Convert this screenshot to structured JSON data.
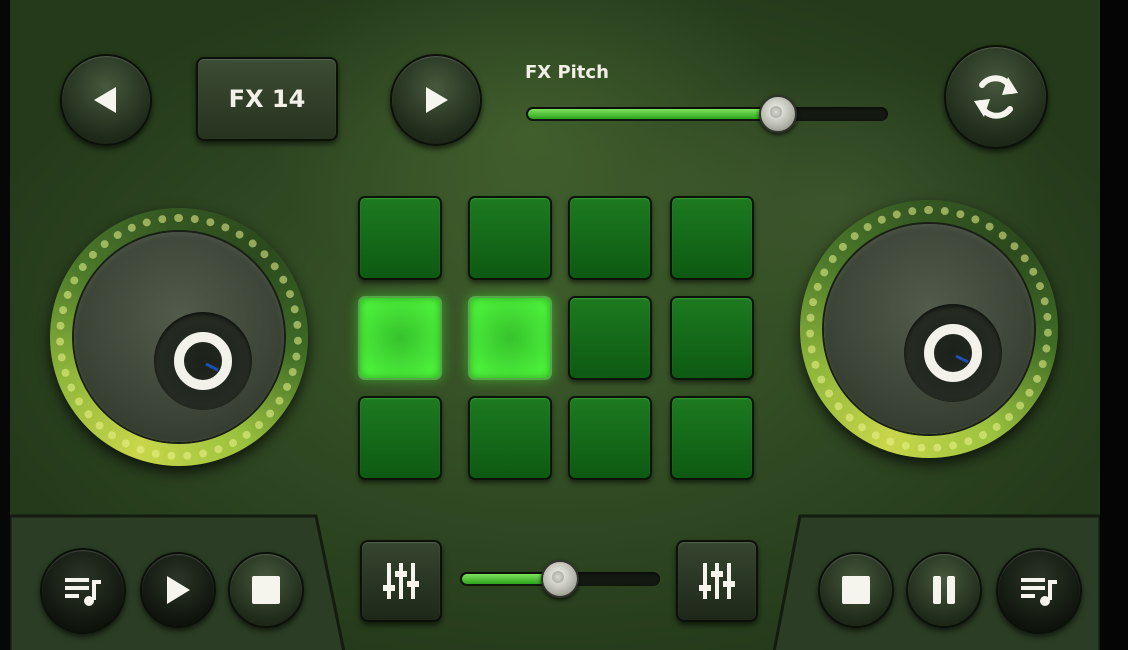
{
  "fx": {
    "preset_label": "FX 14",
    "pitch_label": "FX Pitch",
    "pitch_value": 0.69
  },
  "crossfader": {
    "value": 0.49
  },
  "pads": {
    "rows": 3,
    "cols": 4,
    "active": [
      4,
      5
    ]
  },
  "colors": {
    "accent_green": "#4df03c",
    "pad_green": "#1d7a20",
    "deck_ring": "#c8d64a"
  },
  "icons": {
    "prev": "prev-icon",
    "next": "next-icon",
    "sync": "sync-icon",
    "playlist": "playlist-icon",
    "play": "play-icon",
    "stop": "stop-icon",
    "pause": "pause-icon",
    "eq": "equalizer-icon"
  }
}
